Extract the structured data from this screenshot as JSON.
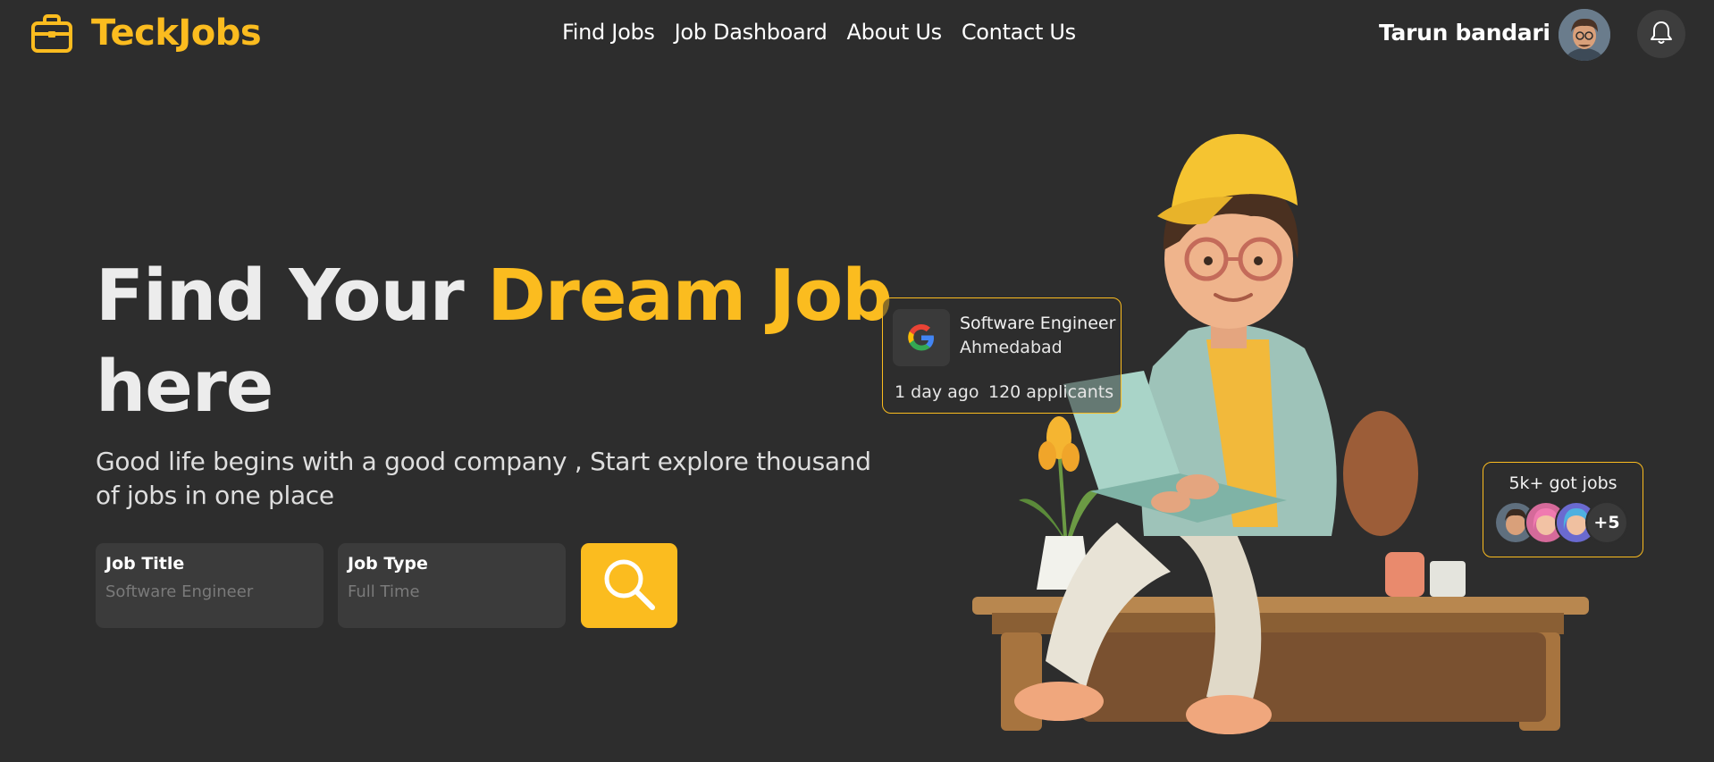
{
  "brand": {
    "name": "TeckJobs",
    "icon": "briefcase-icon",
    "accent_color": "#fbbc1f"
  },
  "nav": [
    {
      "label": "Find Jobs"
    },
    {
      "label": "Job Dashboard"
    },
    {
      "label": "About Us"
    },
    {
      "label": "Contact Us"
    }
  ],
  "user": {
    "name": "Tarun bandari",
    "avatar_icon": "user-avatar",
    "notification_icon": "bell-icon"
  },
  "hero": {
    "title_part1": "Find Your ",
    "title_accent": "Dream Job",
    "title_part2": "here",
    "subtitle": "Good life begins with a good company , Start explore thousand of jobs in one place"
  },
  "search": {
    "job_title_label": "Job Title",
    "job_title_placeholder": "Software Engineer",
    "job_type_label": "Job Type",
    "job_type_placeholder": "Full Time",
    "button_icon": "search-icon"
  },
  "job_card": {
    "company_logo": "google-logo",
    "title": "Software Engineer",
    "location": "Ahmedabad",
    "posted": "1 day ago",
    "applicants": "120 applicants"
  },
  "stat_card": {
    "label": "5k+ got jobs",
    "more": "+5"
  },
  "colors": {
    "background": "#2d2d2d",
    "accent": "#fbbc1f",
    "field_bg": "#3b3b3b"
  }
}
